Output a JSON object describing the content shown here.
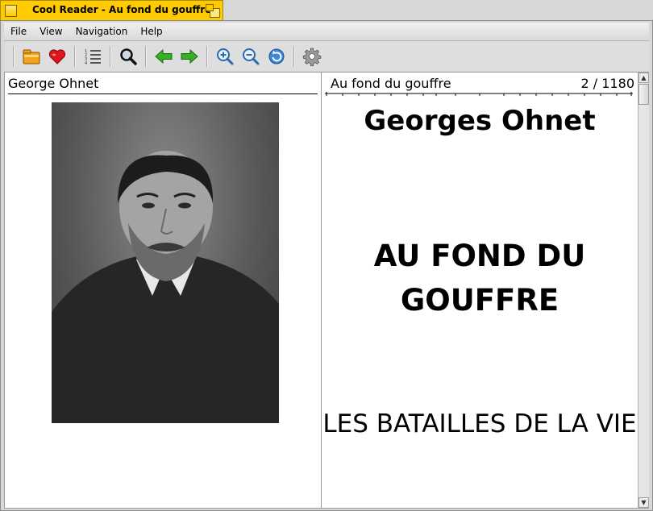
{
  "window": {
    "title": "Cool Reader - Au fond du gouffre",
    "accent_color": "#ffcb00"
  },
  "menubar": {
    "items": [
      "File",
      "View",
      "Navigation",
      "Help"
    ]
  },
  "toolbar": {
    "icons": [
      "open-file-icon",
      "favorites-heart-icon",
      "table-of-contents-icon",
      "search-icon",
      "back-arrow-icon",
      "forward-arrow-icon",
      "zoom-in-icon",
      "zoom-out-icon",
      "rotate-icon",
      "settings-gear-icon"
    ]
  },
  "left_page": {
    "header": "George Ohnet"
  },
  "right_page": {
    "header": "Au fond du gouffre",
    "page_number": "2 / 1180",
    "author": "Georges Ohnet",
    "title_line1": "AU FOND DU",
    "title_line2": "GOUFFRE",
    "series": "LES BATAILLES DE LA VIE"
  }
}
